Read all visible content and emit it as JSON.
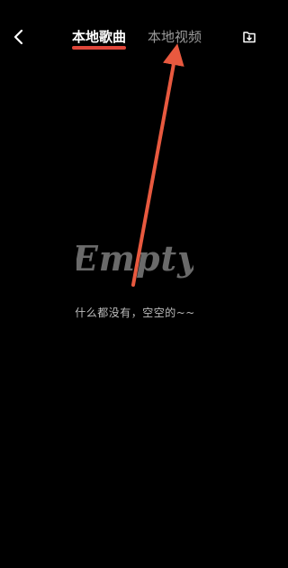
{
  "header": {
    "tabs": [
      {
        "label": "本地歌曲",
        "active": true
      },
      {
        "label": "本地视频",
        "active": false
      }
    ],
    "back_icon": "chevron-left-icon",
    "import_icon": "download-folder-icon"
  },
  "empty_state": {
    "logo_text": "Empty",
    "message": "什么都没有，空空的~~"
  },
  "colors": {
    "background": "#000000",
    "accent": "#e0473b",
    "inactive_tab": "#9a9a9a",
    "empty_logo": "#6a6a6a",
    "annotation_arrow": "#e8593f"
  }
}
